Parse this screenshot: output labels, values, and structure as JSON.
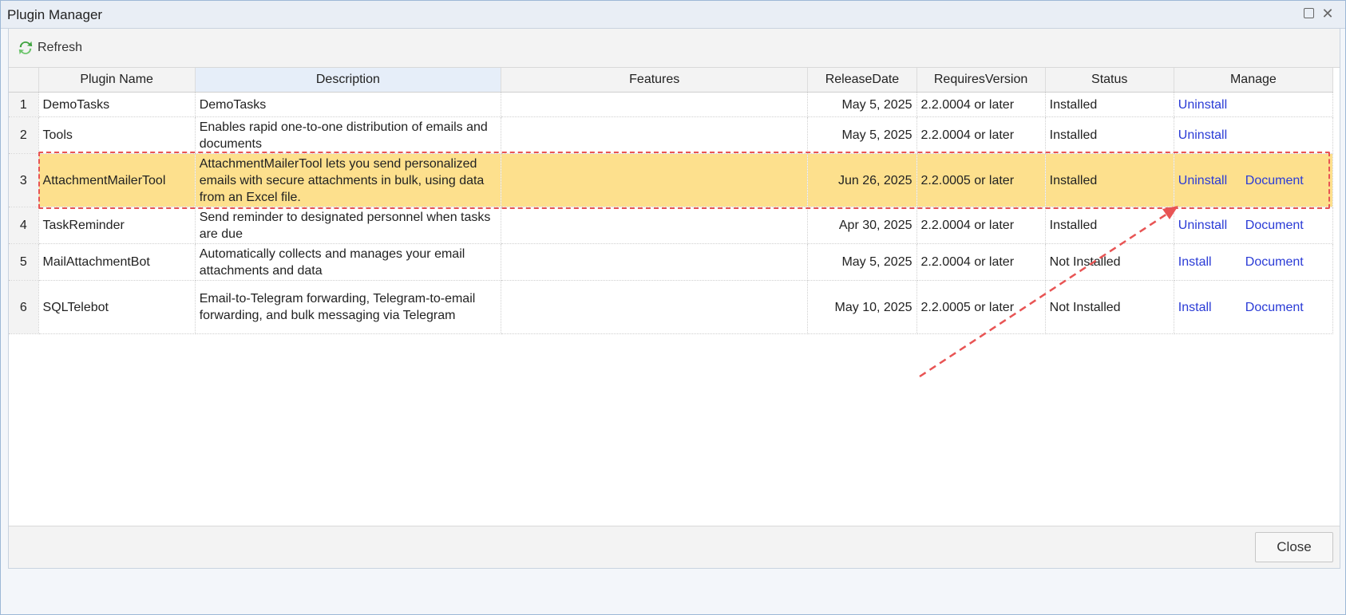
{
  "window": {
    "title": "Plugin Manager"
  },
  "toolbar": {
    "refresh_label": "Refresh"
  },
  "table": {
    "columns": [
      "Plugin Name",
      "Description",
      "Features",
      "ReleaseDate",
      "RequiresVersion",
      "Status",
      "Manage"
    ],
    "rows": [
      {
        "num": "1",
        "name": "DemoTasks",
        "description": "DemoTasks",
        "features": "",
        "release_date": "May 5, 2025",
        "requires": "2.2.0004 or later",
        "status": "Installed",
        "action": "Uninstall",
        "doc": ""
      },
      {
        "num": "2",
        "name": "Tools",
        "description": "Enables rapid one-to-one distribution of emails and documents",
        "features": "",
        "release_date": "May 5, 2025",
        "requires": "2.2.0004 or later",
        "status": "Installed",
        "action": "Uninstall",
        "doc": ""
      },
      {
        "num": "3",
        "name": "AttachmentMailerTool",
        "description": "AttachmentMailerTool lets you send personalized emails with secure attachments in bulk, using data from an Excel file.",
        "features": "",
        "release_date": "Jun 26, 2025",
        "requires": "2.2.0005 or later",
        "status": "Installed",
        "action": "Uninstall",
        "doc": "Document"
      },
      {
        "num": "4",
        "name": "TaskReminder",
        "description": "Send reminder to designated personnel when tasks are due",
        "features": "",
        "release_date": "Apr 30, 2025",
        "requires": "2.2.0004 or later",
        "status": "Installed",
        "action": "Uninstall",
        "doc": "Document"
      },
      {
        "num": "5",
        "name": "MailAttachmentBot",
        "description": "Automatically collects and manages your email attachments and data",
        "features": "",
        "release_date": "May 5, 2025",
        "requires": "2.2.0004 or later",
        "status": "Not Installed",
        "action": "Install",
        "doc": "Document"
      },
      {
        "num": "6",
        "name": "SQLTelebot",
        "description": "Email-to-Telegram forwarding, Telegram-to-email forwarding, and bulk messaging via Telegram",
        "features": "",
        "release_date": "May 10, 2025",
        "requires": "2.2.0005 or later",
        "status": "Not Installed",
        "action": "Install",
        "doc": "Document"
      }
    ],
    "highlighted_row": "3"
  },
  "footer": {
    "close_label": "Close"
  },
  "colors": {
    "highlight_row": "#fde08d",
    "annotation": "#e85454",
    "link": "#2a3bd6"
  }
}
